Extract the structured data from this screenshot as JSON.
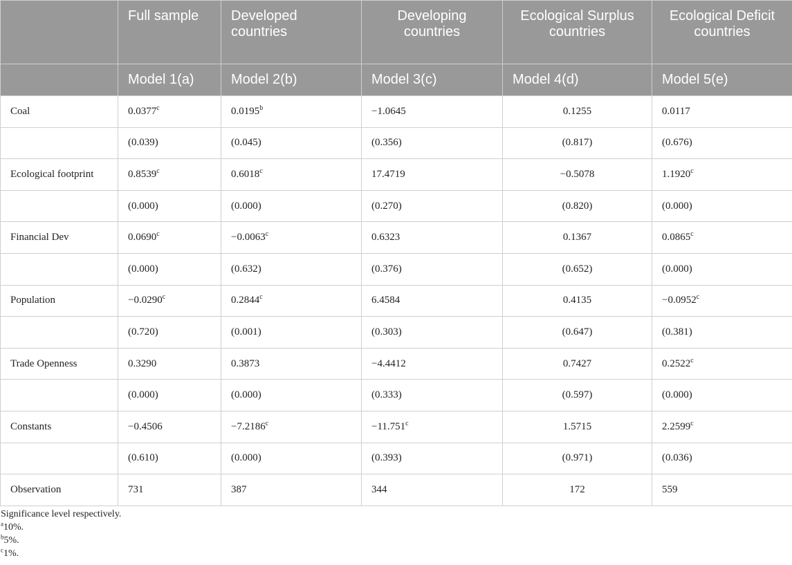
{
  "table": {
    "group_headers": [
      "",
      "Full sample",
      "Developed countries",
      "Developing countries",
      "Ecological Surplus countries",
      "Ecological Deficit countries"
    ],
    "model_headers": [
      "",
      "Model 1(a)",
      "Model 2(b)",
      "Model 3(c)",
      "Model 4(d)",
      "Model 5(e)"
    ],
    "rows": [
      {
        "label": "Coal",
        "cells": [
          {
            "v": "0.0377",
            "s": "c"
          },
          {
            "v": "0.0195",
            "s": "b"
          },
          {
            "v": "−1.0645",
            "s": ""
          },
          {
            "v": "0.1255",
            "s": ""
          },
          {
            "v": "0.0117",
            "s": ""
          }
        ]
      },
      {
        "label": "",
        "cells": [
          {
            "v": "(0.039)",
            "s": ""
          },
          {
            "v": "(0.045)",
            "s": ""
          },
          {
            "v": "(0.356)",
            "s": ""
          },
          {
            "v": "(0.817)",
            "s": ""
          },
          {
            "v": "(0.676)",
            "s": ""
          }
        ]
      },
      {
        "label": "Ecological footprint",
        "cells": [
          {
            "v": "0.8539",
            "s": "c"
          },
          {
            "v": "0.6018",
            "s": "c"
          },
          {
            "v": "17.4719",
            "s": ""
          },
          {
            "v": "−0.5078",
            "s": ""
          },
          {
            "v": "1.1920",
            "s": "c"
          }
        ]
      },
      {
        "label": "",
        "cells": [
          {
            "v": "(0.000)",
            "s": ""
          },
          {
            "v": "(0.000)",
            "s": ""
          },
          {
            "v": "(0.270)",
            "s": ""
          },
          {
            "v": "(0.820)",
            "s": ""
          },
          {
            "v": "(0.000)",
            "s": ""
          }
        ]
      },
      {
        "label": "Financial Dev",
        "cells": [
          {
            "v": "0.0690",
            "s": "c"
          },
          {
            "v": "−0.0063",
            "s": "c"
          },
          {
            "v": "0.6323",
            "s": ""
          },
          {
            "v": "0.1367",
            "s": ""
          },
          {
            "v": "0.0865",
            "s": "c"
          }
        ]
      },
      {
        "label": "",
        "cells": [
          {
            "v": "(0.000)",
            "s": ""
          },
          {
            "v": "(0.632)",
            "s": ""
          },
          {
            "v": "(0.376)",
            "s": ""
          },
          {
            "v": "(0.652)",
            "s": ""
          },
          {
            "v": "(0.000)",
            "s": ""
          }
        ]
      },
      {
        "label": "Population",
        "cells": [
          {
            "v": "−0.0290",
            "s": "c"
          },
          {
            "v": "0.2844",
            "s": "c"
          },
          {
            "v": "6.4584",
            "s": ""
          },
          {
            "v": "0.4135",
            "s": ""
          },
          {
            "v": "−0.0952",
            "s": "c"
          }
        ]
      },
      {
        "label": "",
        "cells": [
          {
            "v": "(0.720)",
            "s": ""
          },
          {
            "v": "(0.001)",
            "s": ""
          },
          {
            "v": "(0.303)",
            "s": ""
          },
          {
            "v": "(0.647)",
            "s": ""
          },
          {
            "v": "(0.381)",
            "s": ""
          }
        ]
      },
      {
        "label": "Trade Openness",
        "cells": [
          {
            "v": "0.3290",
            "s": ""
          },
          {
            "v": "0.3873",
            "s": ""
          },
          {
            "v": "−4.4412",
            "s": ""
          },
          {
            "v": "0.7427",
            "s": ""
          },
          {
            "v": "0.2522",
            "s": "c"
          }
        ]
      },
      {
        "label": "",
        "cells": [
          {
            "v": "(0.000)",
            "s": ""
          },
          {
            "v": "(0.000)",
            "s": ""
          },
          {
            "v": "(0.333)",
            "s": ""
          },
          {
            "v": "(0.597)",
            "s": ""
          },
          {
            "v": "(0.000)",
            "s": ""
          }
        ]
      },
      {
        "label": "Constants",
        "cells": [
          {
            "v": "−0.4506",
            "s": ""
          },
          {
            "v": "−7.2186",
            "s": "c"
          },
          {
            "v": "−11.751",
            "s": "c"
          },
          {
            "v": "1.5715",
            "s": ""
          },
          {
            "v": "2.2599",
            "s": "c"
          }
        ]
      },
      {
        "label": "",
        "cells": [
          {
            "v": "(0.610)",
            "s": ""
          },
          {
            "v": "(0.000)",
            "s": ""
          },
          {
            "v": "(0.393)",
            "s": ""
          },
          {
            "v": "(0.971)",
            "s": ""
          },
          {
            "v": "(0.036)",
            "s": ""
          }
        ]
      },
      {
        "label": "Observation",
        "cells": [
          {
            "v": "731",
            "s": ""
          },
          {
            "v": "387",
            "s": ""
          },
          {
            "v": "344",
            "s": ""
          },
          {
            "v": "172",
            "s": ""
          },
          {
            "v": "559",
            "s": ""
          }
        ]
      }
    ]
  },
  "footnotes": {
    "intro": "Significance level respectively.",
    "items": [
      {
        "mark": "a",
        "text": "10%."
      },
      {
        "mark": "b",
        "text": "5%."
      },
      {
        "mark": "c",
        "text": "1%."
      }
    ]
  },
  "colors": {
    "header_bg": "#999999",
    "header_text": "#ffffff",
    "grid": "#cfcfcf"
  }
}
